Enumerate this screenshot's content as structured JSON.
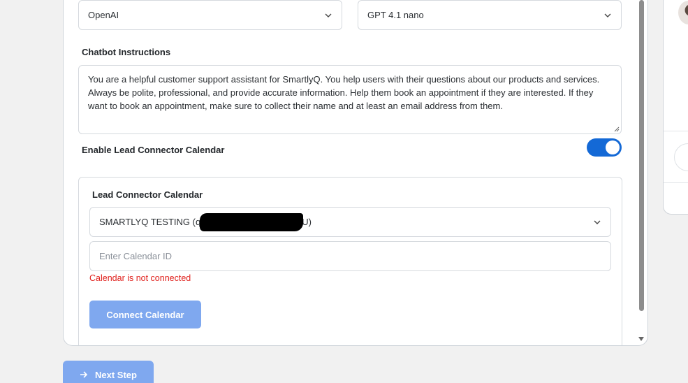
{
  "form": {
    "provider_select": {
      "value": "OpenAI"
    },
    "model_select": {
      "value": "GPT 4.1 nano"
    },
    "instructions": {
      "label": "Chatbot Instructions",
      "value": "You are a helpful customer support assistant for SmartlyQ. You help users with their questions about our products and services. Always be polite, professional, and provide accurate information. Help them book an appointment if they are interested. If they want to book an appointment, make sure to collect their name and at least an email address from them."
    },
    "calendar_toggle": {
      "label": "Enable Lead Connector Calendar",
      "enabled": true,
      "color": "#1469d6"
    },
    "calendar_section": {
      "title": "Lead Connector Calendar",
      "calendar_select": {
        "value_prefix": "SMARTLYQ TESTING (q",
        "value_suffix": "U)"
      },
      "calendar_id_input": {
        "placeholder": "Enter Calendar ID",
        "value": ""
      },
      "error_text": "Calendar is not connected",
      "connect_button": "Connect Calendar"
    }
  },
  "footer": {
    "next_button": "Next Step"
  },
  "colors": {
    "accent": "#1469d6",
    "button_disabled": "#7fa8ef",
    "error": "#e0201c"
  },
  "icons": {
    "dropdown": "chevron-down-icon",
    "next": "arrow-right-icon"
  }
}
